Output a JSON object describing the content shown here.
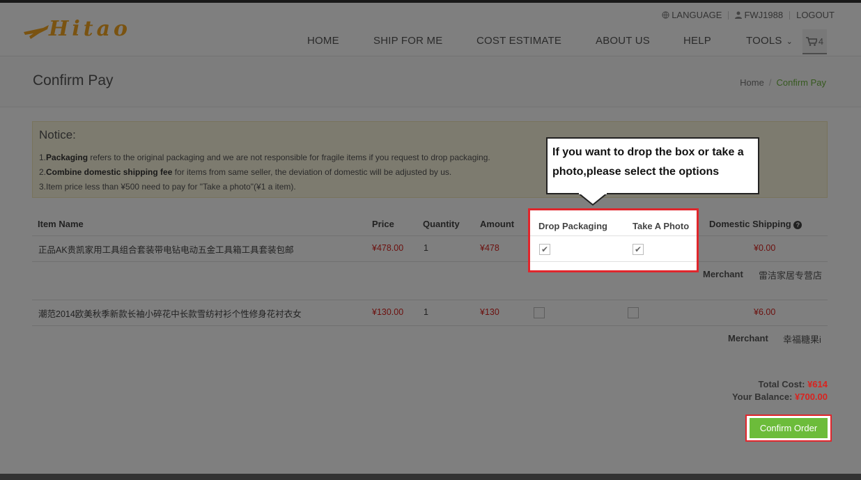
{
  "header": {
    "logo_text": "Hitao",
    "toplinks": {
      "language": "LANGUAGE",
      "user": "FWJ1988",
      "logout": "LOGOUT"
    },
    "nav": [
      "HOME",
      "SHIP FOR ME",
      "COST ESTIMATE",
      "ABOUT US",
      "HELP",
      "TOOLS"
    ],
    "cart_count": "4"
  },
  "page": {
    "title": "Confirm Pay",
    "breadcrumb": {
      "home": "Home",
      "separator": "/",
      "current": "Confirm Pay"
    }
  },
  "notice": {
    "title": "Notice:",
    "line1": {
      "prefix": "1.",
      "bold": "Packaging",
      "text": " refers to the original packaging and we are not responsible for fragile items if you request to drop packaging."
    },
    "line2": {
      "prefix": "2.",
      "bold": "Combine domestic shipping fee",
      "text": " for items from same seller, the deviation of domestic will be adjusted by us."
    },
    "line3": "3.Item price less than ¥500 need to pay for \"Take a photo\"(¥1 a item)."
  },
  "table": {
    "headers": {
      "item": "Item Name",
      "price": "Price",
      "quantity": "Quantity",
      "amount": "Amount",
      "drop": "Drop Packaging",
      "photo": "Take A Photo",
      "shipping": "Domestic Shipping"
    },
    "rows": [
      {
        "name": "正品AK贵凯家用工具组合套装带电钻电动五金工具箱工具套装包邮",
        "price": "¥478.00",
        "quantity": "1",
        "amount": "¥478",
        "drop_packaging": true,
        "take_photo": true,
        "shipping": "¥0.00",
        "merchant_label": "Merchant",
        "merchant": "雷洁家居专营店"
      },
      {
        "name": "潮范2014欧美秋季新款长袖小碎花中长款雪纺衬衫个性修身花衬衣女",
        "price": "¥130.00",
        "quantity": "1",
        "amount": "¥130",
        "drop_packaging": false,
        "take_photo": false,
        "shipping": "¥6.00",
        "merchant_label": "Merchant",
        "merchant": "幸福糖果i"
      }
    ]
  },
  "callout": {
    "text": "If you want to drop the box or take a photo,please select the options"
  },
  "totals": {
    "total_label": "Total Cost: ",
    "total": "¥614",
    "balance_label": "Your Balance: ",
    "balance": "¥700.00"
  },
  "actions": {
    "confirm": "Confirm Order"
  },
  "colors": {
    "accent_green": "#6cbc3a",
    "price_red": "#d9231f",
    "highlight_red": "#e0262c"
  }
}
